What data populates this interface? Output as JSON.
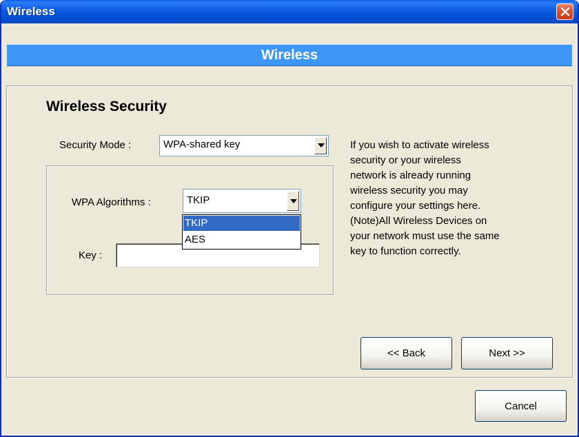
{
  "window": {
    "title": "Wireless"
  },
  "banner": {
    "title": "Wireless"
  },
  "section": {
    "title": "Wireless Security"
  },
  "security_mode": {
    "label": "Security Mode :",
    "value": "WPA-shared key"
  },
  "wpa_algorithms": {
    "label": "WPA Algorithms :",
    "value": "TKIP",
    "options": [
      "TKIP",
      "AES"
    ],
    "highlighted": "TKIP"
  },
  "key": {
    "label": "Key :",
    "value": ""
  },
  "help": {
    "lines": [
      "If you wish to activate wireless",
      "security or your wireless",
      "network is already running",
      "wireless security you may",
      "configure your settings here.",
      "(Note)All Wireless Devices on",
      "your network must use the same",
      "key to function correctly."
    ]
  },
  "buttons": {
    "back": "<< Back",
    "next": "Next >>",
    "cancel": "Cancel"
  },
  "colors": {
    "titlebar": "#0a5fe8",
    "banner": "#3c97f5",
    "dialog_bg": "#ece9d8",
    "selection": "#316ac5"
  }
}
